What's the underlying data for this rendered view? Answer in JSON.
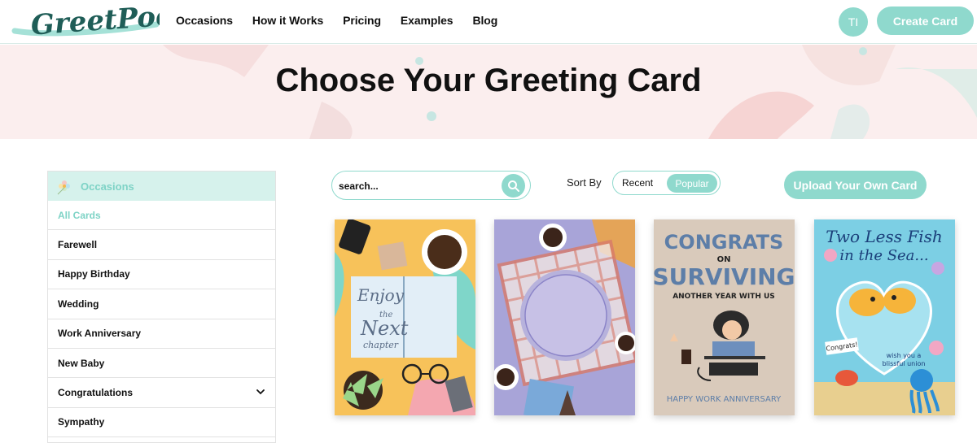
{
  "header": {
    "logo_text": "GreetPool",
    "nav": [
      "Occasions",
      "How it Works",
      "Pricing",
      "Examples",
      "Blog"
    ],
    "avatar_initials": "TI",
    "create_label": "Create Card"
  },
  "hero": {
    "title": "Choose Your Greeting Card"
  },
  "sidebar": {
    "title": "Occasions",
    "items": [
      {
        "label": "All Cards",
        "active": true
      },
      {
        "label": "Farewell"
      },
      {
        "label": "Happy Birthday"
      },
      {
        "label": "Wedding"
      },
      {
        "label": "Work Anniversary"
      },
      {
        "label": "New Baby"
      },
      {
        "label": "Congratulations",
        "expandable": true
      },
      {
        "label": "Sympathy"
      }
    ]
  },
  "controls": {
    "search_placeholder": "search...",
    "sort_label": "Sort By",
    "sort_options": [
      "Recent",
      "Popular"
    ],
    "sort_selected": "Popular",
    "upload_label": "Upload Your Own Card"
  },
  "cards": [
    {
      "name": "enjoy-next-chapter",
      "text": [
        "Enjoy",
        "the",
        "Next",
        "chapter"
      ]
    },
    {
      "name": "picnic-plate",
      "text": []
    },
    {
      "name": "congrats-surviving",
      "text": [
        "CONGRATS",
        "ON",
        "SURVIVING",
        "ANOTHER YEAR WITH US",
        "HAPPY WORK ANNIVERSARY"
      ]
    },
    {
      "name": "two-less-fish",
      "text": [
        "Two Less Fish",
        "in the Sea...",
        "Congrats!",
        "wish you a",
        "blissful union"
      ]
    }
  ],
  "colors": {
    "accent": "#8fd9cd",
    "hero_bg": "#fbeeee",
    "logo": "#1f5d57"
  }
}
